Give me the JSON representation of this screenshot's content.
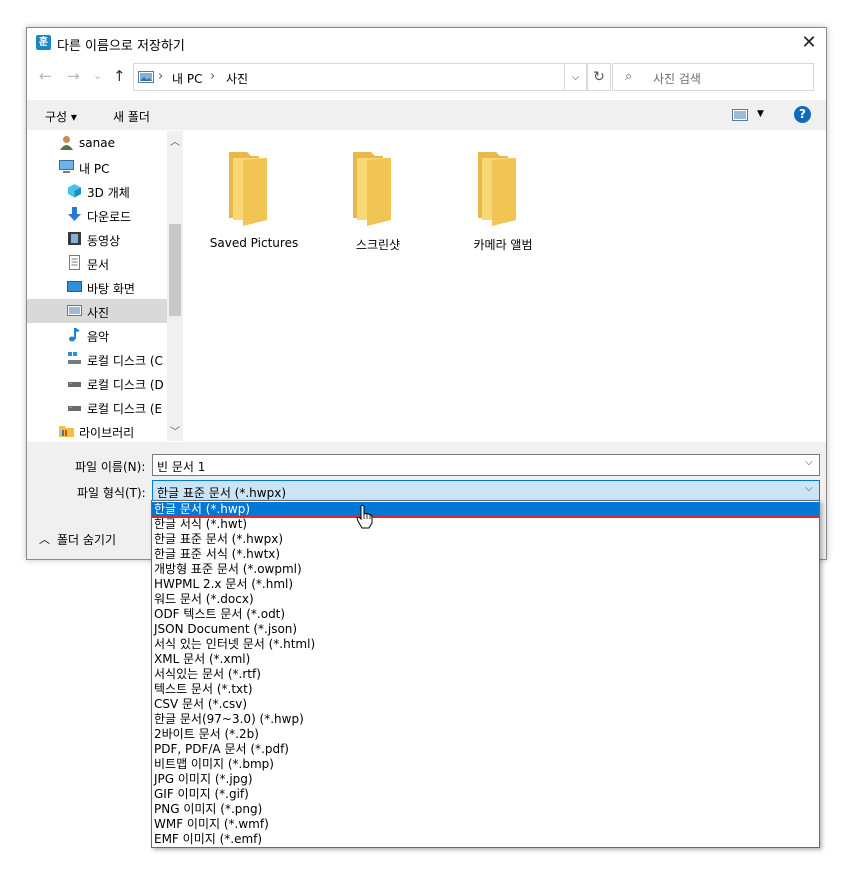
{
  "title": "다른 이름으로 저장하기",
  "app_icon_glyph": "훈",
  "nav": {
    "back": "←",
    "forward": "→",
    "recent": "⌄",
    "up": "↑"
  },
  "address": {
    "crumbs": [
      "내 PC",
      "사진"
    ],
    "sep": "›"
  },
  "search": {
    "placeholder": "사진 검색"
  },
  "toolbar": {
    "organize": "구성 ▾",
    "new_folder": "새 폴더",
    "help": "?"
  },
  "nav_pane": [
    {
      "label": "sanae",
      "icon": "user-icon"
    },
    {
      "label": "내 PC",
      "icon": "computer-icon"
    },
    {
      "label": "3D 개체",
      "icon": "cube-icon"
    },
    {
      "label": "다운로드",
      "icon": "download-icon"
    },
    {
      "label": "동영상",
      "icon": "video-icon"
    },
    {
      "label": "문서",
      "icon": "document-icon"
    },
    {
      "label": "바탕 화면",
      "icon": "desktop-icon"
    },
    {
      "label": "사진",
      "icon": "pictures-icon"
    },
    {
      "label": "음악",
      "icon": "music-icon"
    },
    {
      "label": "로컬 디스크 (C",
      "icon": "drive-icon"
    },
    {
      "label": "로컬 디스크 (D",
      "icon": "drive-icon"
    },
    {
      "label": "로컬 디스크 (E",
      "icon": "drive-icon"
    },
    {
      "label": "라이브러리",
      "icon": "library-icon"
    }
  ],
  "folders": [
    "Saved Pictures",
    "스크린샷",
    "카메라 앨범"
  ],
  "file_name": {
    "label": "파일 이름(N):",
    "value": "빈 문서 1"
  },
  "file_type": {
    "label": "파일 형식(T):",
    "value": "한글 표준 문서 (*.hwpx)"
  },
  "hide_folders": "폴더 숨기기",
  "file_type_options": [
    "한글 문서 (*.hwp)",
    "한글 서식 (*.hwt)",
    "한글 표준 문서 (*.hwpx)",
    "한글 표준 서식 (*.hwtx)",
    "개방형 표준 문서 (*.owpml)",
    "HWPML 2.x 문서 (*.hml)",
    "워드 문서 (*.docx)",
    "ODF 텍스트 문서 (*.odt)",
    "JSON Document (*.json)",
    "서식 있는 인터넷 문서 (*.html)",
    "XML 문서 (*.xml)",
    "서식있는 문서 (*.rtf)",
    "텍스트 문서 (*.txt)",
    "CSV 문서 (*.csv)",
    "한글 문서(97~3.0) (*.hwp)",
    "2바이트 문서 (*.2b)",
    "PDF, PDF/A 문서 (*.pdf)",
    "비트맵 이미지 (*.bmp)",
    "JPG 이미지 (*.jpg)",
    "GIF 이미지 (*.gif)",
    "PNG 이미지 (*.png)",
    "WMF 이미지 (*.wmf)",
    "EMF 이미지 (*.emf)"
  ],
  "selected_option_index": 0,
  "colors": {
    "accent": "#0078d7",
    "highlight_line": "#e0262f",
    "folder": "#f8d775"
  }
}
